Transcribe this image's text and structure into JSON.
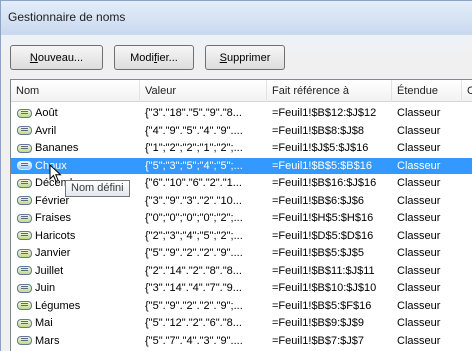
{
  "window": {
    "title": "Gestionnaire de noms"
  },
  "toolbar": {
    "new_mnemonic": "N",
    "new_rest": "ouveau...",
    "edit_before": "Modi",
    "edit_mnemonic": "f",
    "edit_after": "ier...",
    "delete_mnemonic": "S",
    "delete_rest": "upprimer"
  },
  "columns": [
    "Nom",
    "Valeur",
    "Fait référence à",
    "Étendue",
    "Co"
  ],
  "rows": [
    {
      "name": "Août",
      "value": "{\"3\".\"18\".\"5\".\"9\".\"8...",
      "ref": "=Feuil1!$B$12:$J$12",
      "scope": "Classeur"
    },
    {
      "name": "Avril",
      "value": "{\"4\".\"9\".\"5\".\"4\".\"9\"....",
      "ref": "=Feuil1!$B$8:$J$8",
      "scope": "Classeur"
    },
    {
      "name": "Bananes",
      "value": "{\"1\";\"2\";\"2\";\"1\";\"2\";...",
      "ref": "=Feuil1!$J$5:$J$16",
      "scope": "Classeur"
    },
    {
      "name": "Choux",
      "value": "{\"5\";\"3\";\"5\";\"4\";\"5\";...",
      "ref": "=Feuil1!$B$5:$B$16",
      "scope": "Classeur"
    },
    {
      "name": "Décembre",
      "value": "{\"6\".\"10\".\"6\".\"2\".\"1...",
      "ref": "=Feuil1!$B$16:$J$16",
      "scope": "Classeur"
    },
    {
      "name": "Février",
      "value": "{\"3\".\"9\".\"3\".\"2\".\"10...",
      "ref": "=Feuil1!$B$6:$J$6",
      "scope": "Classeur"
    },
    {
      "name": "Fraises",
      "value": "{\"0\";\"0\";\"0\";\"0\";\"2\";...",
      "ref": "=Feuil1!$H$5:$H$16",
      "scope": "Classeur"
    },
    {
      "name": "Haricots",
      "value": "{\"2\";\"3\";\"4\";\"5\";\"2\";...",
      "ref": "=Feuil1!$D$5:$D$16",
      "scope": "Classeur"
    },
    {
      "name": "Janvier",
      "value": "{\"5\".\"9\".\"2\".\"2\".\"9\"....",
      "ref": "=Feuil1!$B$5:$J$5",
      "scope": "Classeur"
    },
    {
      "name": "Juillet",
      "value": "{\"2\".\"14\".\"2\".\"8\".\"8...",
      "ref": "=Feuil1!$B$11:$J$11",
      "scope": "Classeur"
    },
    {
      "name": "Juin",
      "value": "{\"3\".\"14\".\"4\".\"7\".\"9...",
      "ref": "=Feuil1!$B$10:$J$10",
      "scope": "Classeur"
    },
    {
      "name": "Légumes",
      "value": "{\"5\".\"9\".\"2\".\"2\".\"9\";...",
      "ref": "=Feuil1!$B$5:$F$16",
      "scope": "Classeur"
    },
    {
      "name": "Mai",
      "value": "{\"5\".\"12\".\"2\".\"6\".\"8...",
      "ref": "=Feuil1!$B$9:$J$9",
      "scope": "Classeur"
    },
    {
      "name": "Mars",
      "value": "{\"5\".\"7\".\"4\".\"3\".\"9\"....",
      "ref": "=Feuil1!$B$7:$J$7",
      "scope": "Classeur"
    }
  ],
  "selected_row_index": 3,
  "tooltip": {
    "text": "Nom défini"
  },
  "icons": {
    "name_item": "named-range-icon",
    "cursor": "mouse-pointer-icon"
  },
  "colors": {
    "selection": "#3399ff",
    "title_gradient_top": "#e4edf9"
  }
}
